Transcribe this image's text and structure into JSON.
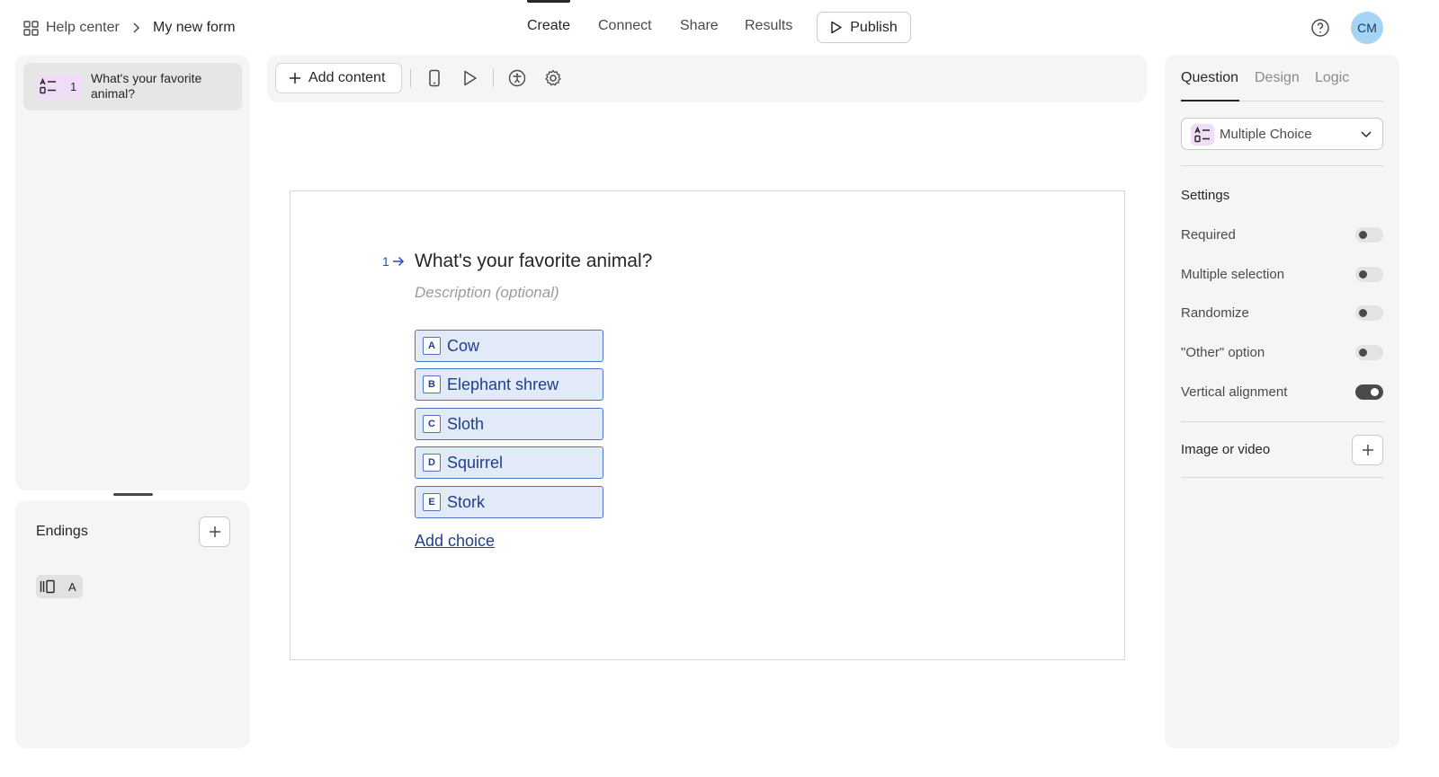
{
  "header": {
    "breadcrumb": {
      "workspace": "Help center",
      "form": "My new form"
    },
    "tabs": [
      {
        "label": "Create",
        "active": true
      },
      {
        "label": "Connect",
        "active": false
      },
      {
        "label": "Share",
        "active": false
      },
      {
        "label": "Results",
        "active": false
      }
    ],
    "publish_label": "Publish",
    "avatar_initials": "CM",
    "icons": [
      "grid-icon",
      "chevron-right-icon",
      "play-icon",
      "help-icon"
    ]
  },
  "sidebar": {
    "questions": [
      {
        "number": "1",
        "title": "What's your favorite animal?",
        "type_icon": "multiple-choice-icon"
      }
    ],
    "endings": {
      "title": "Endings",
      "items": [
        {
          "letter": "A",
          "icon": "ending-icon"
        }
      ]
    }
  },
  "toolbar": {
    "add_content_label": "Add content",
    "icons": [
      "mobile-preview-icon",
      "play-preview-icon",
      "accessibility-icon",
      "settings-gear-icon"
    ]
  },
  "canvas": {
    "question_number": "1",
    "question_title": "What's your favorite animal?",
    "description_placeholder": "Description (optional)",
    "choices": [
      {
        "key": "A",
        "label": "Cow"
      },
      {
        "key": "B",
        "label": "Elephant shrew"
      },
      {
        "key": "C",
        "label": "Sloth"
      },
      {
        "key": "D",
        "label": "Squirrel"
      },
      {
        "key": "E",
        "label": "Stork"
      }
    ],
    "add_choice_label": "Add choice"
  },
  "right_panel": {
    "tabs": [
      {
        "label": "Question",
        "active": true
      },
      {
        "label": "Design",
        "active": false
      },
      {
        "label": "Logic",
        "active": false
      }
    ],
    "question_type": "Multiple Choice",
    "settings_heading": "Settings",
    "settings": [
      {
        "label": "Required",
        "enabled": false
      },
      {
        "label": "Multiple selection",
        "enabled": false
      },
      {
        "label": "Randomize",
        "enabled": false
      },
      {
        "label": "\"Other\" option",
        "enabled": false
      },
      {
        "label": "Vertical alignment",
        "enabled": true
      }
    ],
    "media_heading": "Image or video"
  },
  "colors": {
    "accent_blue": "#1f3f8f",
    "choice_bg": "#e2e9f7",
    "question_type_badge": "#f0dcf6",
    "avatar_bg": "#a6d4f5"
  }
}
